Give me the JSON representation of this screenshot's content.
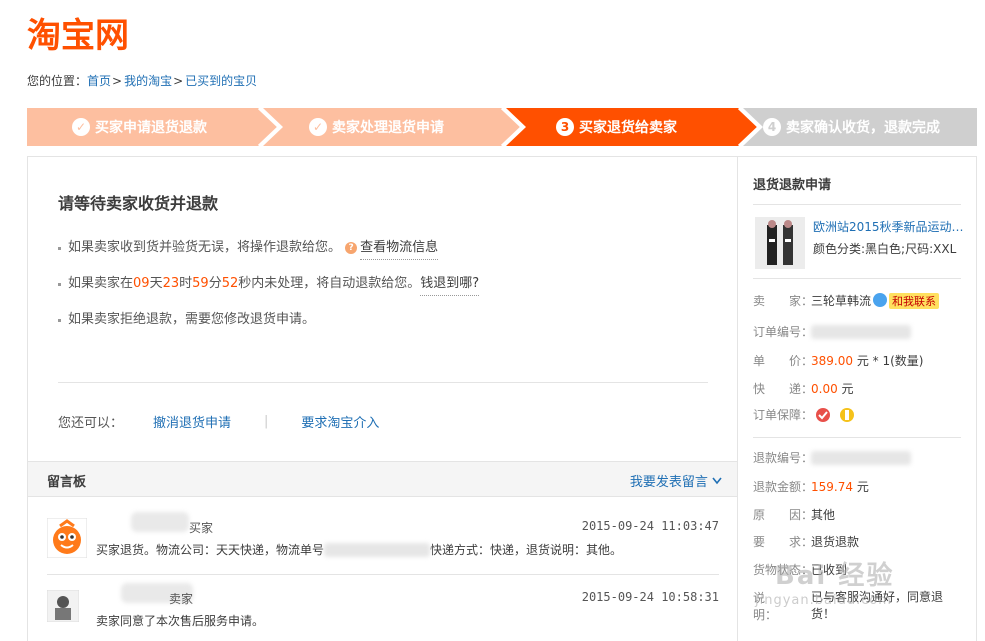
{
  "logo": {
    "text": "淘宝网"
  },
  "breadcrumb": {
    "label": "您的位置：",
    "items": [
      "首页",
      "我的淘宝",
      "已买到的宝贝"
    ],
    "sep": ">"
  },
  "steps": [
    {
      "label": "买家申请退货退款",
      "marker": "✓",
      "state": "done"
    },
    {
      "label": "卖家处理退货申请",
      "marker": "✓",
      "state": "done"
    },
    {
      "label": "买家退货给卖家",
      "marker": "3",
      "state": "current"
    },
    {
      "label": "卖家确认收货，退款完成",
      "marker": "4",
      "state": "todo"
    }
  ],
  "colors": {
    "brand": "#ff5000",
    "done_step": "#fdbfa0",
    "todo_step": "#cfcfcf",
    "link": "#1f6fb4"
  },
  "status": {
    "title": "请等待卖家收货并退款",
    "line1": "如果卖家收到货并验货无误，将操作退款给您。",
    "line1_link": "查看物流信息",
    "line2_prefix": "如果卖家在",
    "days": "09",
    "days_unit": "天",
    "hours": "23",
    "hours_unit": "时",
    "minutes": "59",
    "minutes_unit": "分",
    "seconds": "52",
    "seconds_unit": "秒",
    "line2_suffix": "内未处理，将自动退款给您。",
    "line2_link": "钱退到哪?",
    "line3": "如果卖家拒绝退款，需要您修改退货申请。"
  },
  "actions": {
    "label": "您还可以：",
    "cancel": "撤消退货申请",
    "intervene": "要求淘宝介入"
  },
  "messages": {
    "title": "留言板",
    "post_link": "我要发表留言",
    "items": [
      {
        "role": "买家",
        "time": "2015-09-24 11:03:47",
        "body_a": "买家退货。物流公司：天天快递，物流单号",
        "body_b": "快递方式：快递，退货说明：其他。"
      },
      {
        "role": "卖家",
        "time": "2015-09-24 10:58:31",
        "body_a": "卖家同意了本次售后服务申请。",
        "body_b": ""
      }
    ]
  },
  "side": {
    "title": "退货退款申请",
    "product_name": "欧洲站2015秋季新品运动…",
    "product_spec": "颜色分类:黑白色;尺码:XXL",
    "seller_label": "卖　　家：",
    "seller_name": "三轮草韩流",
    "contact": "和我联系",
    "order_no_label": "订单编号：",
    "price_label": "单　　价：",
    "price": "389.00",
    "price_unit": "元 * 1(数量)",
    "shipping_label": "快　　递：",
    "shipping": "0.00",
    "shipping_unit": "元",
    "guarantee_label": "订单保障：",
    "refund_no_label": "退款编号：",
    "refund_amount_label": "退款金额：",
    "refund_amount": "159.74",
    "refund_amount_unit": "元",
    "reason_label": "原　　因：",
    "reason": "其他",
    "request_label": "要　　求：",
    "request": "退货退款",
    "state_label": "货物状态：",
    "state": "已收到",
    "note_label": "说　　明：",
    "note": "已与客服沟通好，同意退货！"
  },
  "watermark": {
    "brand": "Bai 经验",
    "url": "jingyan.baidu.com"
  }
}
